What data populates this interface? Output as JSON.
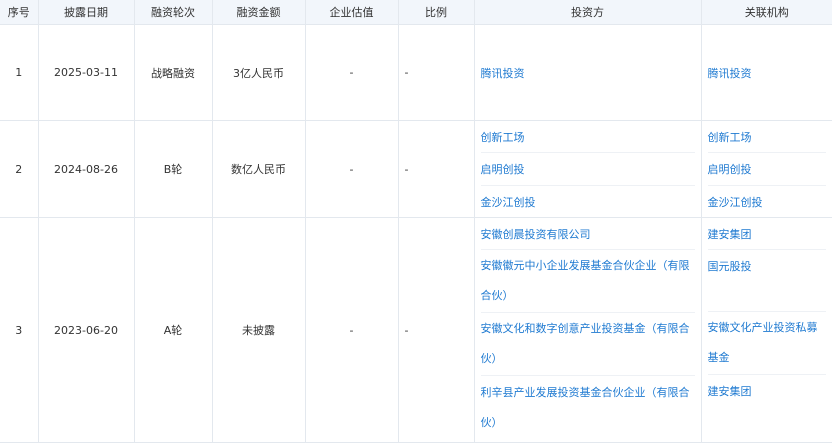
{
  "headers": [
    "序号",
    "披露日期",
    "融资轮次",
    "融资金额",
    "企业估值",
    "比例",
    "投资方",
    "关联机构"
  ],
  "rows": [
    {
      "no": "1",
      "date": "2025-03-11",
      "round": "战略融资",
      "amount": "3亿人民币",
      "valuation": "-",
      "ratio": "-",
      "investors": [
        "腾讯投资"
      ],
      "related": [
        "腾讯投资"
      ]
    },
    {
      "no": "2",
      "date": "2024-08-26",
      "round": "B轮",
      "amount": "数亿人民币",
      "valuation": "-",
      "ratio": "-",
      "investors": [
        "创新工场",
        "启明创投",
        "金沙江创投"
      ],
      "related": [
        "创新工场",
        "启明创投",
        "金沙江创投"
      ]
    },
    {
      "no": "3",
      "date": "2023-06-20",
      "round": "A轮",
      "amount": "未披露",
      "valuation": "-",
      "ratio": "-",
      "investors": [
        "安徽创晨投资有限公司",
        "安徽徽元中小企业发展基金合伙企业（有限合伙）",
        "安徽文化和数字创意产业投资基金（有限合伙）",
        "利辛县产业发展投资基金合伙企业（有限合伙）"
      ],
      "related": [
        "建安集团",
        "国元股投",
        "安徽文化产业投资私募基金",
        "建安集团"
      ]
    }
  ]
}
